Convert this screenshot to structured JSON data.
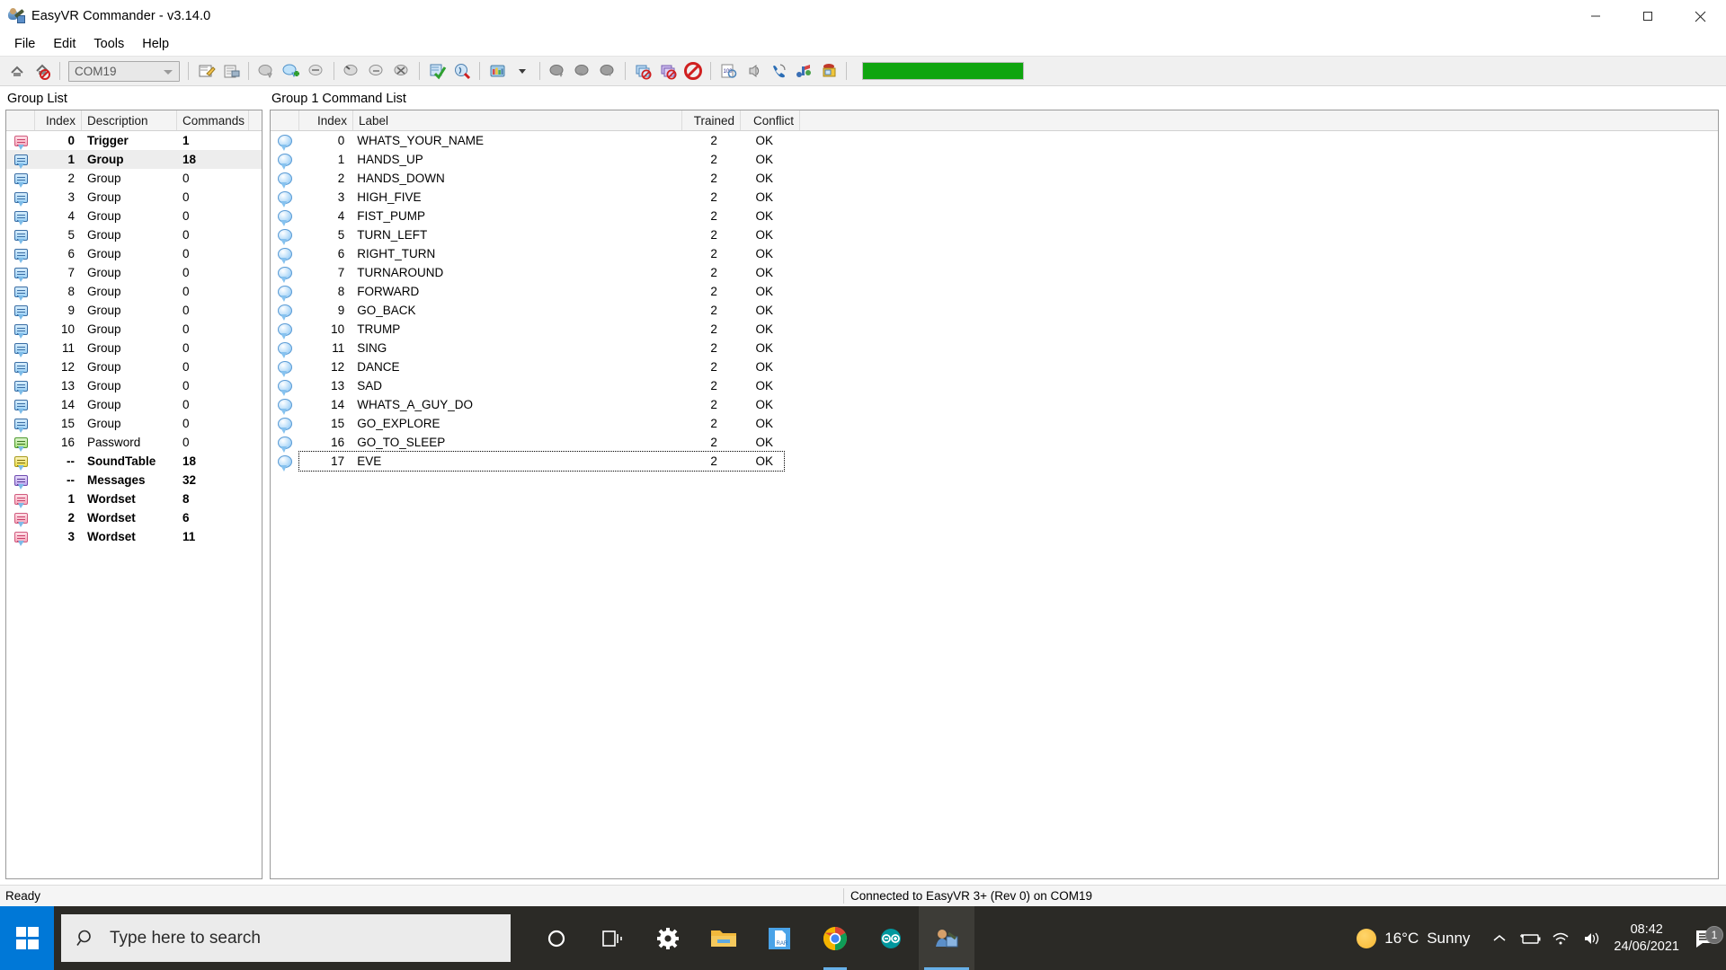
{
  "window": {
    "title": "EasyVR Commander - v3.14.0",
    "icon": "app-person-wrench-icon",
    "controls": {
      "minimize": "minimize-icon",
      "maximize": "maximize-icon",
      "close": "close-icon"
    }
  },
  "menubar": {
    "items": [
      "File",
      "Edit",
      "Tools",
      "Help"
    ]
  },
  "toolbar": {
    "port_value": "COM19",
    "progress_percent": 100,
    "progress_color": "#0fa50f",
    "buttons": [
      "connect-icon",
      "disconnect-icon",
      "new-project-icon",
      "open-project-icon",
      "add-group-icon",
      "add-command-icon",
      "remove-group-icon",
      "remove-command-icon",
      "rename-command-icon",
      "erase-command-icon",
      "train-command-icon",
      "test-command-icon",
      "sound-table-icon",
      "sound-dropdown-icon",
      "grammar-icon",
      "grammar2-icon",
      "grammar3-icon",
      "delete-group-icon",
      "delete-all-icon",
      "cancel-icon",
      "generate-code-icon",
      "speaker-icon",
      "phone-icon",
      "bridge-icon",
      "wizard-icon"
    ]
  },
  "group_list": {
    "caption": "Group List",
    "columns": [
      "",
      "Index",
      "Description",
      "Commands"
    ],
    "rows": [
      {
        "icon": "bubble-pink-icon",
        "index": "0",
        "description": "Trigger",
        "commands": "1",
        "bold": true,
        "selected": false
      },
      {
        "icon": "bubble-blue-icon",
        "index": "1",
        "description": "Group",
        "commands": "18",
        "bold": true,
        "selected": true
      },
      {
        "icon": "bubble-blue-icon",
        "index": "2",
        "description": "Group",
        "commands": "0",
        "bold": false,
        "selected": false
      },
      {
        "icon": "bubble-blue-icon",
        "index": "3",
        "description": "Group",
        "commands": "0",
        "bold": false,
        "selected": false
      },
      {
        "icon": "bubble-blue-icon",
        "index": "4",
        "description": "Group",
        "commands": "0",
        "bold": false,
        "selected": false
      },
      {
        "icon": "bubble-blue-icon",
        "index": "5",
        "description": "Group",
        "commands": "0",
        "bold": false,
        "selected": false
      },
      {
        "icon": "bubble-blue-icon",
        "index": "6",
        "description": "Group",
        "commands": "0",
        "bold": false,
        "selected": false
      },
      {
        "icon": "bubble-blue-icon",
        "index": "7",
        "description": "Group",
        "commands": "0",
        "bold": false,
        "selected": false
      },
      {
        "icon": "bubble-blue-icon",
        "index": "8",
        "description": "Group",
        "commands": "0",
        "bold": false,
        "selected": false
      },
      {
        "icon": "bubble-blue-icon",
        "index": "9",
        "description": "Group",
        "commands": "0",
        "bold": false,
        "selected": false
      },
      {
        "icon": "bubble-blue-icon",
        "index": "10",
        "description": "Group",
        "commands": "0",
        "bold": false,
        "selected": false
      },
      {
        "icon": "bubble-blue-icon",
        "index": "11",
        "description": "Group",
        "commands": "0",
        "bold": false,
        "selected": false
      },
      {
        "icon": "bubble-blue-icon",
        "index": "12",
        "description": "Group",
        "commands": "0",
        "bold": false,
        "selected": false
      },
      {
        "icon": "bubble-blue-icon",
        "index": "13",
        "description": "Group",
        "commands": "0",
        "bold": false,
        "selected": false
      },
      {
        "icon": "bubble-blue-icon",
        "index": "14",
        "description": "Group",
        "commands": "0",
        "bold": false,
        "selected": false
      },
      {
        "icon": "bubble-blue-icon",
        "index": "15",
        "description": "Group",
        "commands": "0",
        "bold": false,
        "selected": false
      },
      {
        "icon": "bubble-green-icon",
        "index": "16",
        "description": "Password",
        "commands": "0",
        "bold": false,
        "selected": false
      },
      {
        "icon": "bubble-yellow-icon",
        "index": "--",
        "description": "SoundTable",
        "commands": "18",
        "bold": true,
        "selected": false
      },
      {
        "icon": "bubble-purple-icon",
        "index": "--",
        "description": "Messages",
        "commands": "32",
        "bold": true,
        "selected": false
      },
      {
        "icon": "bubble-pink-icon",
        "index": "1",
        "description": "Wordset",
        "commands": "8",
        "bold": true,
        "selected": false
      },
      {
        "icon": "bubble-pink-icon",
        "index": "2",
        "description": "Wordset",
        "commands": "6",
        "bold": true,
        "selected": false
      },
      {
        "icon": "bubble-pink-icon",
        "index": "3",
        "description": "Wordset",
        "commands": "11",
        "bold": true,
        "selected": false
      }
    ]
  },
  "command_list": {
    "caption": "Group 1 Command List",
    "columns": [
      "",
      "Index",
      "Label",
      "Trained",
      "Conflict"
    ],
    "rows": [
      {
        "icon": "bubble-round-icon",
        "index": "0",
        "label": "WHATS_YOUR_NAME",
        "trained": "2",
        "conflict": "OK",
        "focused": false
      },
      {
        "icon": "bubble-round-icon",
        "index": "1",
        "label": "HANDS_UP",
        "trained": "2",
        "conflict": "OK",
        "focused": false
      },
      {
        "icon": "bubble-round-icon",
        "index": "2",
        "label": "HANDS_DOWN",
        "trained": "2",
        "conflict": "OK",
        "focused": false
      },
      {
        "icon": "bubble-round-icon",
        "index": "3",
        "label": "HIGH_FIVE",
        "trained": "2",
        "conflict": "OK",
        "focused": false
      },
      {
        "icon": "bubble-round-icon",
        "index": "4",
        "label": "FIST_PUMP",
        "trained": "2",
        "conflict": "OK",
        "focused": false
      },
      {
        "icon": "bubble-round-icon",
        "index": "5",
        "label": "TURN_LEFT",
        "trained": "2",
        "conflict": "OK",
        "focused": false
      },
      {
        "icon": "bubble-round-icon",
        "index": "6",
        "label": "RIGHT_TURN",
        "trained": "2",
        "conflict": "OK",
        "focused": false
      },
      {
        "icon": "bubble-round-icon",
        "index": "7",
        "label": "TURNAROUND",
        "trained": "2",
        "conflict": "OK",
        "focused": false
      },
      {
        "icon": "bubble-round-icon",
        "index": "8",
        "label": "FORWARD",
        "trained": "2",
        "conflict": "OK",
        "focused": false
      },
      {
        "icon": "bubble-round-icon",
        "index": "9",
        "label": "GO_BACK",
        "trained": "2",
        "conflict": "OK",
        "focused": false
      },
      {
        "icon": "bubble-round-icon",
        "index": "10",
        "label": "TRUMP",
        "trained": "2",
        "conflict": "OK",
        "focused": false
      },
      {
        "icon": "bubble-round-icon",
        "index": "11",
        "label": "SING",
        "trained": "2",
        "conflict": "OK",
        "focused": false
      },
      {
        "icon": "bubble-round-icon",
        "index": "12",
        "label": "DANCE",
        "trained": "2",
        "conflict": "OK",
        "focused": false
      },
      {
        "icon": "bubble-round-icon",
        "index": "13",
        "label": "SAD",
        "trained": "2",
        "conflict": "OK",
        "focused": false
      },
      {
        "icon": "bubble-round-icon",
        "index": "14",
        "label": "WHATS_A_GUY_DO",
        "trained": "2",
        "conflict": "OK",
        "focused": false
      },
      {
        "icon": "bubble-round-icon",
        "index": "15",
        "label": "GO_EXPLORE",
        "trained": "2",
        "conflict": "OK",
        "focused": false
      },
      {
        "icon": "bubble-round-icon",
        "index": "16",
        "label": "GO_TO_SLEEP",
        "trained": "2",
        "conflict": "OK",
        "focused": false
      },
      {
        "icon": "bubble-round-icon",
        "index": "17",
        "label": "EVE",
        "trained": "2",
        "conflict": "OK",
        "focused": true
      }
    ]
  },
  "statusbar": {
    "left": "Ready",
    "right": "Connected to EasyVR 3+ (Rev 0) on COM19"
  },
  "taskbar": {
    "start": "windows-start-icon",
    "search_placeholder": "Type here to search",
    "apps": [
      {
        "name": "cortana-icon",
        "state": "idle"
      },
      {
        "name": "task-view-icon",
        "state": "idle"
      },
      {
        "name": "settings-icon",
        "state": "idle"
      },
      {
        "name": "file-explorer-icon",
        "state": "idle"
      },
      {
        "name": "winrar-icon",
        "state": "idle"
      },
      {
        "name": "chrome-icon",
        "state": "running"
      },
      {
        "name": "arduino-icon",
        "state": "idle"
      },
      {
        "name": "easyvr-commander-icon",
        "state": "active"
      }
    ],
    "tray": {
      "weather_temp": "16°C",
      "weather_desc": "Sunny",
      "weather_icon": "sun-icon",
      "chevron": "show-hidden-icons-chevron",
      "battery": "battery-charging-icon",
      "network": "wifi-icon",
      "volume": "speaker-icon",
      "time": "08:42",
      "date": "24/06/2021",
      "notification_count": "1"
    }
  }
}
